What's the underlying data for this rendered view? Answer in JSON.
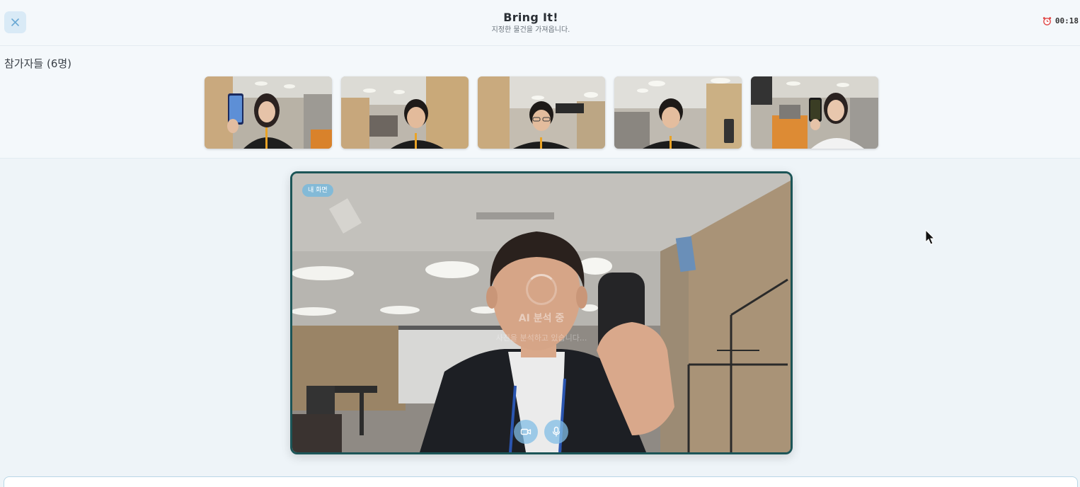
{
  "header": {
    "title": "Bring It!",
    "subtitle": "지정한 물건을 가져옵니다.",
    "timer": "00:18",
    "close_icon": "close-icon",
    "timer_icon": "alarm-clock-icon"
  },
  "participants": {
    "title": "참가자들 (6명)",
    "thumbnails": [
      {
        "label": "participant-1"
      },
      {
        "label": "participant-2"
      },
      {
        "label": "participant-3"
      },
      {
        "label": "participant-4"
      },
      {
        "label": "participant-5"
      }
    ]
  },
  "main_video": {
    "badge": "내 화면",
    "ai_title": "AI 분석 중",
    "ai_subtitle": "사진을 분석하고 있습니다...",
    "controls": [
      "camera-icon",
      "microphone-icon"
    ]
  },
  "colors": {
    "accent": "#1c5557",
    "header_bg": "#f4f8fb",
    "page_bg": "#eef4f8",
    "badge_bg": "#78b9dc"
  }
}
